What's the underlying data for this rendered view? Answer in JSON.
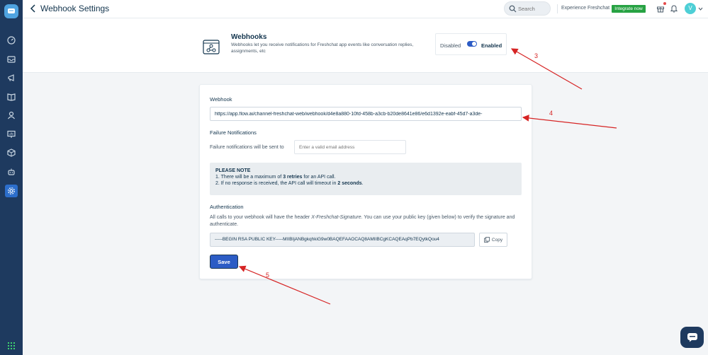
{
  "colors": {
    "sidebar": "#1e3a5f",
    "accent": "#2c5cc5",
    "integrate": "#27a243",
    "annotation": "#d62424"
  },
  "header": {
    "title": "Webhook Settings",
    "search_placeholder": "Search",
    "experience_label": "Experience Freshchat",
    "integrate_label": "Integrate now",
    "avatar_initial": "V"
  },
  "banner": {
    "title": "Webhooks",
    "description": "Webhooks let you receive notifications for Freshchat app events like conversation replies, assignments, etc",
    "toggle": {
      "off_label": "Disabled",
      "on_label": "Enabled",
      "enabled": true
    }
  },
  "card": {
    "webhook_label": "Webhook",
    "webhook_url": "https://app.flow.ai/channel-freshchat-web/webhook/d4e8a880-10fd-458b-a3cb-b20de8641e86/e6d1392e-eabf-45d7-a3de-",
    "failure_label": "Failure Notifications",
    "failure_sub": "Failure notifications will be sent to",
    "email_placeholder": "Enter a valid email address",
    "note": {
      "title": "PLEASE NOTE",
      "line1_a": "1. There will be a maximum of ",
      "line1_b": "3 retries",
      "line1_c": " for an API call.",
      "line2_a": "2. If no response is received, the API call will timeout in ",
      "line2_b": "2 seconds",
      "line2_c": "."
    },
    "auth_label": "Authentication",
    "auth_desc_a": "All calls to your webhook will have the header ",
    "auth_desc_b": "X-Freshchat-Signature",
    "auth_desc_c": ". You can use your public key (given below) to verify the signature and authenticate.",
    "public_key": "-----BEGIN RSA PUBLIC KEY-----MIIBIjANBgkqhkiG9w0BAQEFAAOCAQ8AMIIBCgKCAQEAqPb7EQytkQou4",
    "copy_label": "Copy",
    "save_label": "Save"
  },
  "annotations": {
    "n3": "3",
    "n4": "4",
    "n5": "5"
  },
  "icons": [
    "logo-icon",
    "dashboard-icon",
    "inbox-icon",
    "campaigns-icon",
    "knowledge-icon",
    "contacts-icon",
    "reports-icon",
    "apps-icon",
    "bot-icon",
    "settings-icon",
    "grid-icon",
    "chat-icon"
  ]
}
